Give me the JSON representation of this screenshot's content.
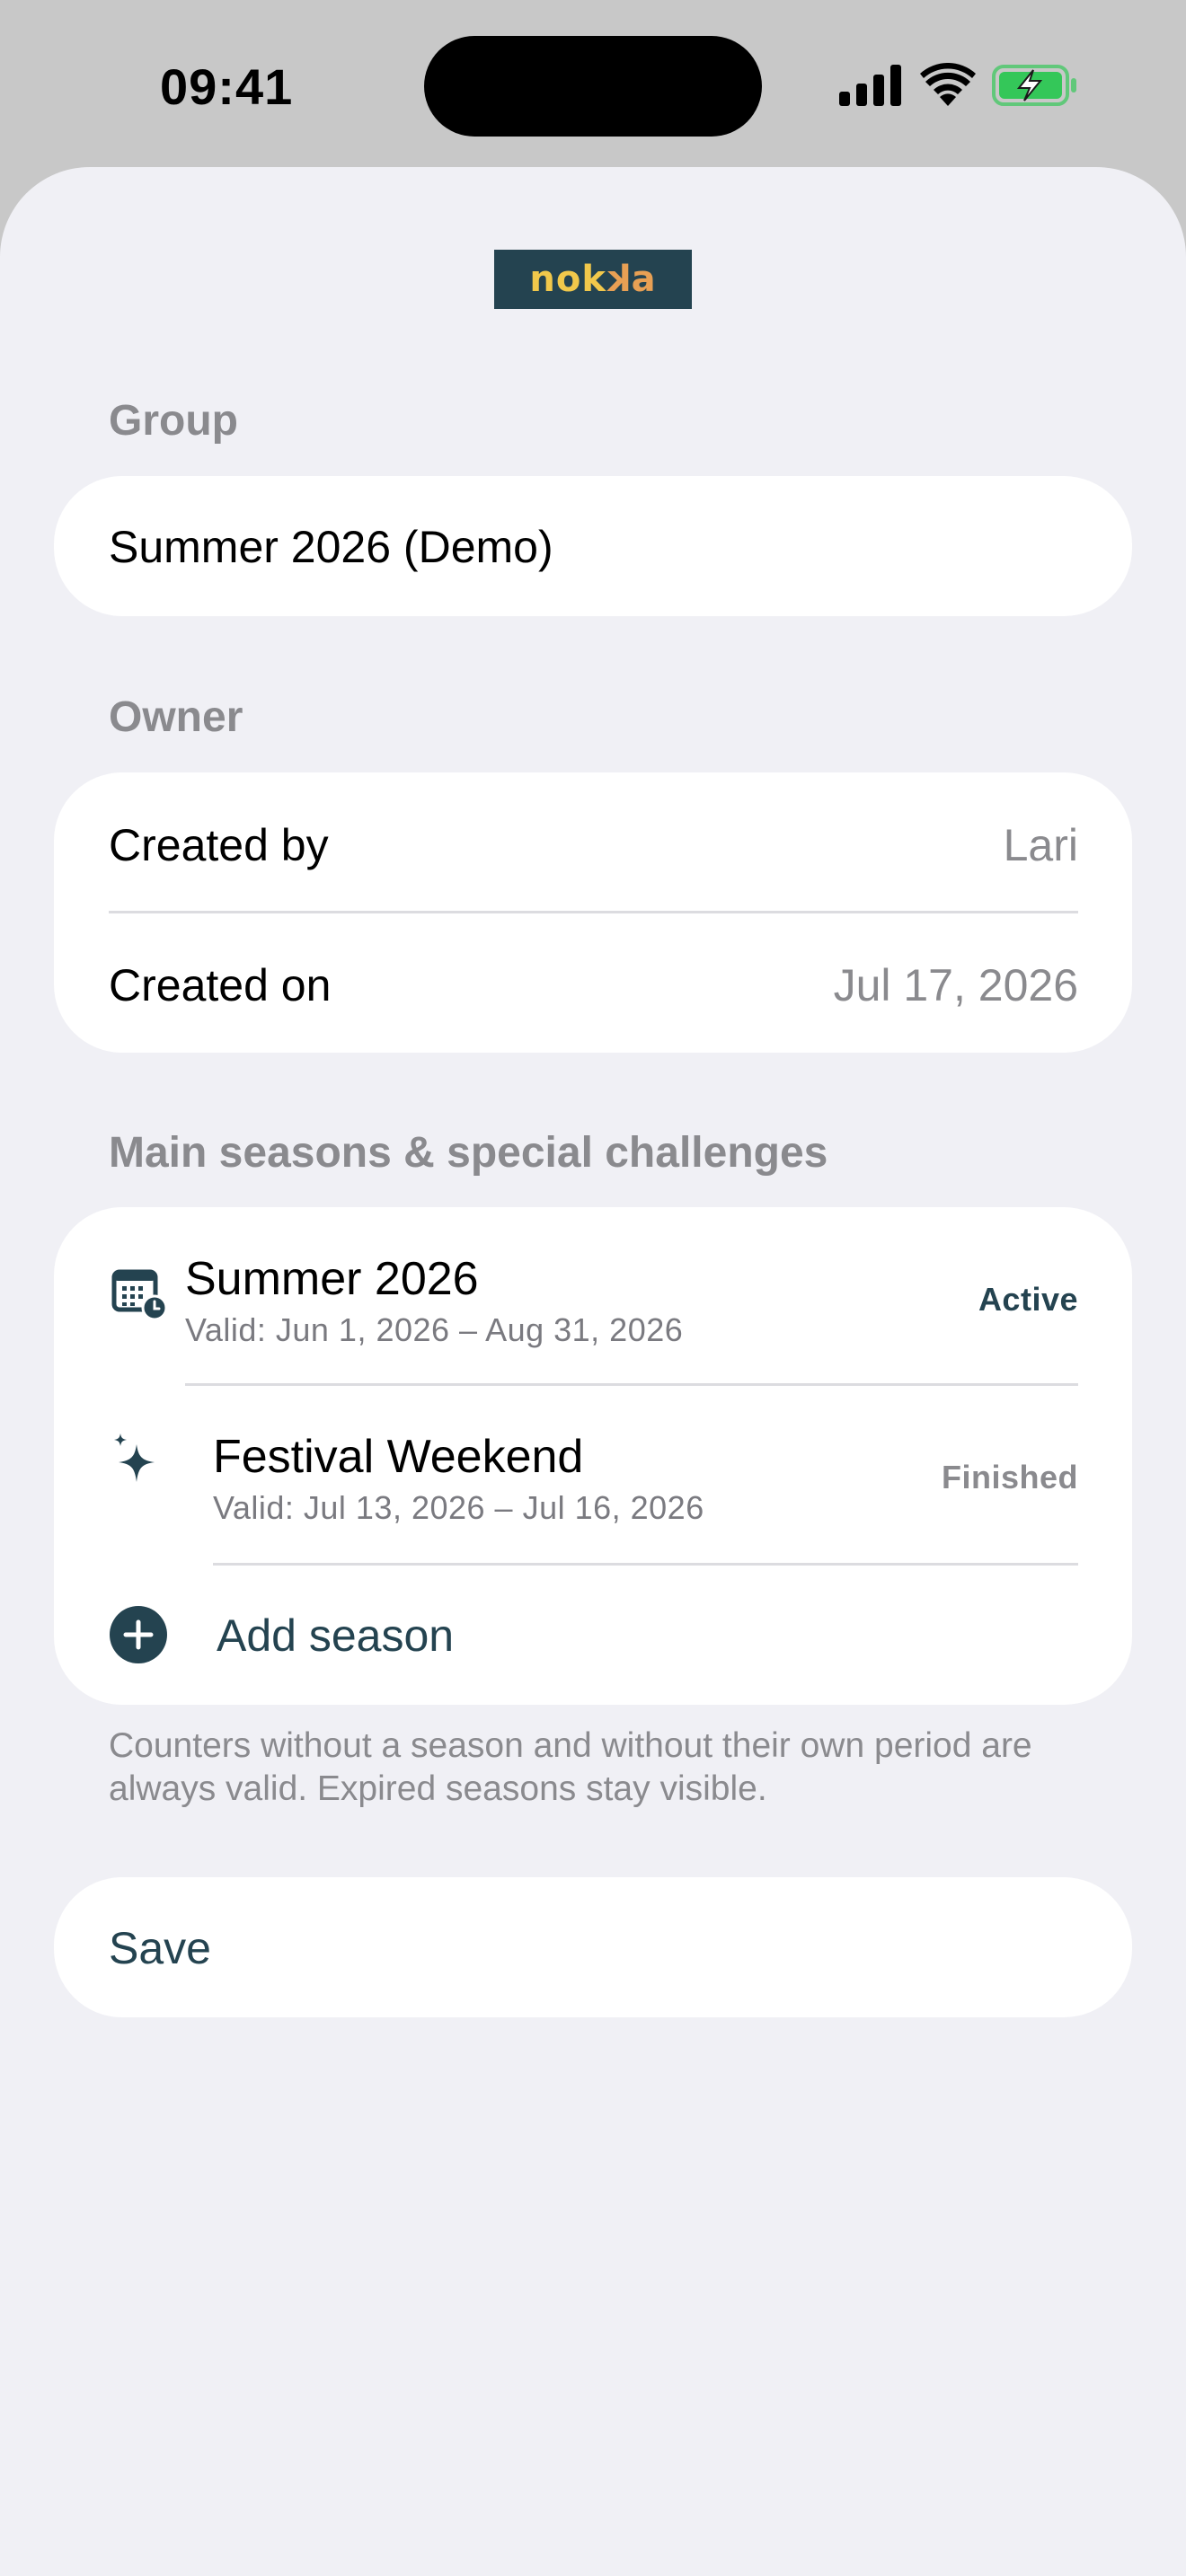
{
  "status_bar": {
    "time": "09:41"
  },
  "logo": {
    "text_part1": "nok",
    "text_part2": "a",
    "text_mid": "k"
  },
  "group": {
    "header": "Group",
    "value": "Summer 2026 (Demo)"
  },
  "owner": {
    "header": "Owner",
    "created_by_label": "Created by",
    "created_by_value": "Lari",
    "created_on_label": "Created on",
    "created_on_value": "Jul 17, 2026"
  },
  "seasons": {
    "header": "Main seasons & special challenges",
    "items": [
      {
        "title": "Summer 2026",
        "validity": "Valid: Jun 1, 2026 – Aug 31, 2026",
        "status": "Active",
        "status_color": "#244350",
        "icon": "calendar-clock-icon"
      },
      {
        "title": "Festival Weekend",
        "validity": "Valid: Jul 13, 2026 – Jul 16, 2026",
        "status": "Finished",
        "status_color": "#8a8a8e",
        "icon": "sparkles-icon"
      }
    ],
    "add_label": "Add season",
    "footer": "Counters without a season and without their own period are always valid. Expired seasons stay visible."
  },
  "actions": {
    "save_label": "Save"
  },
  "colors": {
    "accent": "#244350",
    "background": "#f0f0f5",
    "secondary_text": "#8a8a8e",
    "battery_green": "#34c759"
  }
}
